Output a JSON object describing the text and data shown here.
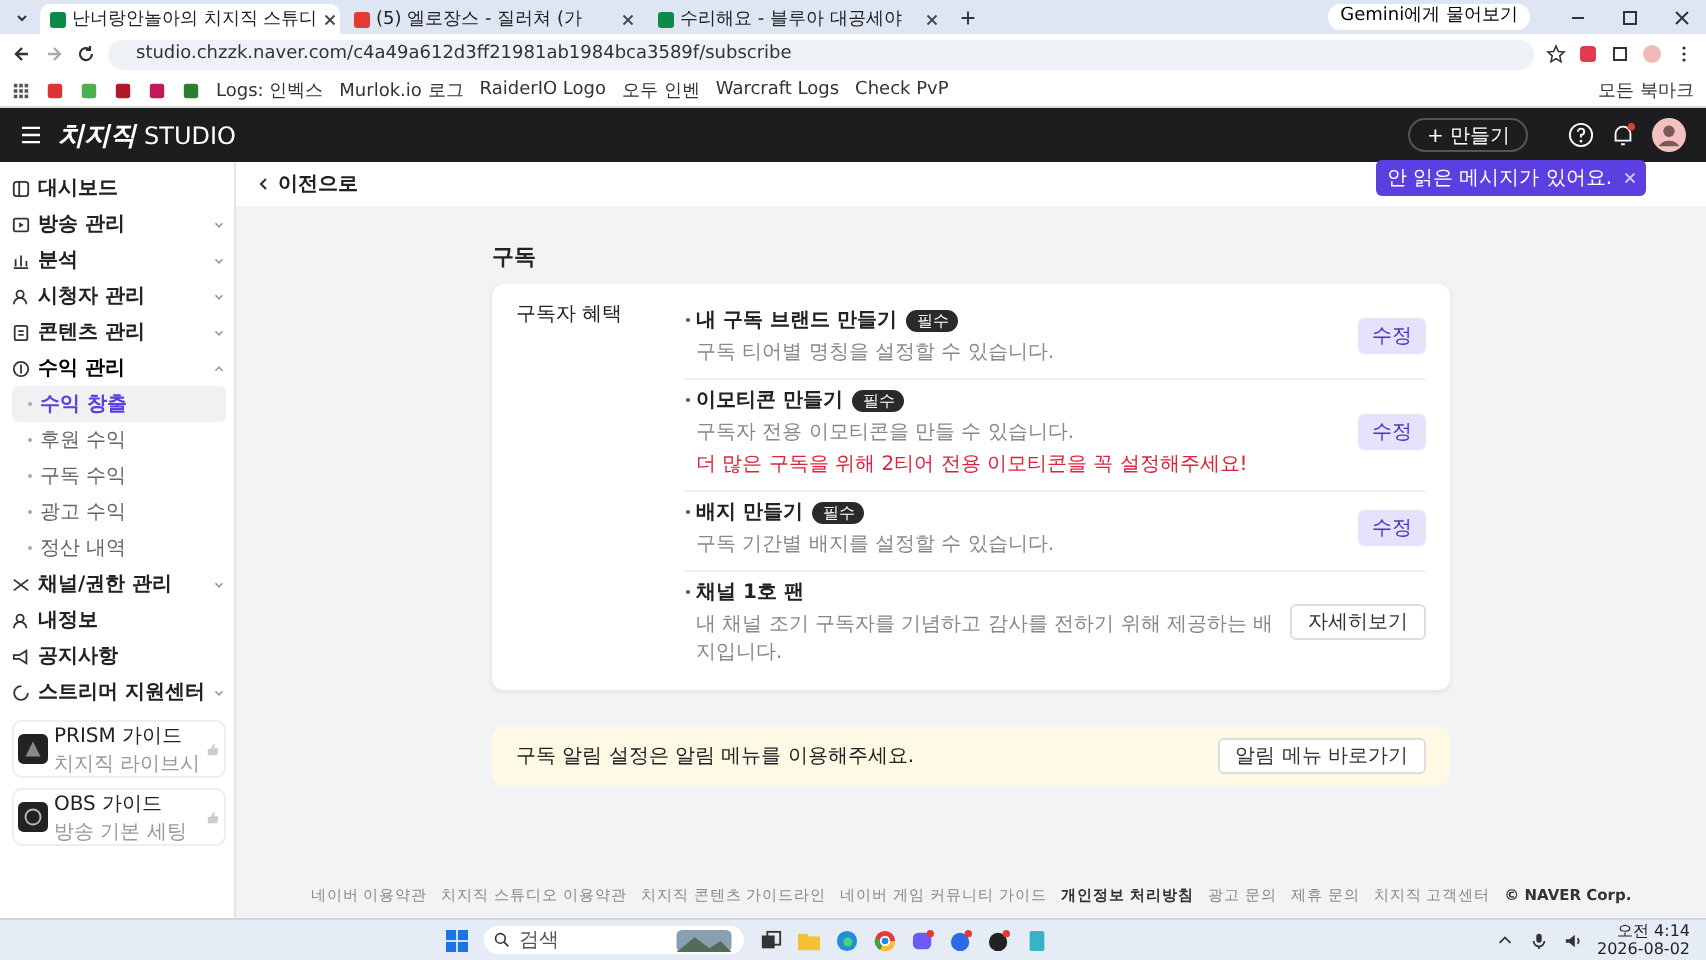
{
  "browser": {
    "tabs": [
      {
        "title": "난너랑안놀아의 치지직 스튜디",
        "selected": true
      },
      {
        "title": "(5) 엘로장스 - 질러쳐 (가",
        "selected": false
      },
      {
        "title": "수리해요 - 블루아 대공세야",
        "selected": false
      }
    ],
    "gemini_button": "Gemini에게 물어보기",
    "url": "studio.chzzk.naver.com/c4a49a612d3ff21981ab1984bca3589f/subscribe",
    "bookmarks": [
      {
        "label": "Logs: 인벡스"
      },
      {
        "label": "Murlok.io 로그"
      },
      {
        "label": "RaiderIO Logo"
      },
      {
        "label": "오두 인벤"
      },
      {
        "label": "Warcraft Logs"
      },
      {
        "label": "Check PvP"
      }
    ],
    "all_bookmarks": "모든 북마크"
  },
  "header": {
    "logo": "치지직",
    "logo_suffix": "STUDIO",
    "create_button": "+ 만들기",
    "tooltip": "안 읽은 메시지가 있어요."
  },
  "back_link": "이전으로",
  "sidebar": {
    "items": [
      {
        "label": "대시보드",
        "expandable": false,
        "expanded": false
      },
      {
        "label": "방송 관리",
        "expandable": true,
        "expanded": false
      },
      {
        "label": "분석",
        "expandable": true,
        "expanded": false
      },
      {
        "label": "시청자 관리",
        "expandable": true,
        "expanded": false
      },
      {
        "label": "콘텐츠 관리",
        "expandable": true,
        "expanded": false
      },
      {
        "label": "수익 관리",
        "expandable": true,
        "expanded": true,
        "children": [
          {
            "label": "수익 창출",
            "selected": true
          },
          {
            "label": "후원 수익",
            "selected": false
          },
          {
            "label": "구독 수익",
            "selected": false
          },
          {
            "label": "광고 수익",
            "selected": false
          },
          {
            "label": "정산 내역",
            "selected": false
          }
        ]
      },
      {
        "label": "채널/권한 관리",
        "expandable": true,
        "expanded": false
      },
      {
        "label": "내정보",
        "expandable": false,
        "expanded": false
      },
      {
        "label": "공지사항",
        "expandable": false,
        "expanded": false
      },
      {
        "label": "스트리머 지원센터",
        "expandable": true,
        "expanded": false
      }
    ],
    "guides": [
      {
        "title": "PRISM 가이드",
        "subtitle": "치지직 라이브시"
      },
      {
        "title": "OBS 가이드",
        "subtitle": "방송 기본 세팅"
      }
    ]
  },
  "page_title": "구독",
  "benefits": {
    "label": "구독자 혜택",
    "items": [
      {
        "kind": "edit",
        "title": "내 구독 브랜드 만들기",
        "badge": "필수",
        "description": "구독 티어별 명칭을 설정할 수 있습니다.",
        "button": "수정"
      },
      {
        "kind": "edit",
        "title": "이모티콘 만들기",
        "badge": "필수",
        "description": "구독자 전용 이모티콘을 만들 수 있습니다.",
        "warning": "더 많은 구독을 위해 2티어 전용 이모티콘을 꼭 설정해주세요!",
        "button": "수정"
      },
      {
        "kind": "edit",
        "title": "배지 만들기",
        "badge": "필수",
        "description": "구독 기간별 배지를 설정할 수 있습니다.",
        "button": "수정"
      },
      {
        "kind": "info",
        "title": "채널 1호 팬",
        "description": "내 채널 조기 구독자를 기념하고 감사를 전하기 위해 제공하는 배지입니다.",
        "button": "자세히보기"
      }
    ]
  },
  "notice": {
    "text": "구독 알림 설정은 알림 메뉴를 이용해주세요.",
    "button": "알림 메뉴 바로가기"
  },
  "footer": [
    {
      "label": "네이버 이용약관",
      "bold": false
    },
    {
      "label": "치지직 스튜디오 이용약관",
      "bold": false
    },
    {
      "label": "치지직 콘텐츠 가이드라인",
      "bold": false
    },
    {
      "label": "네이버 게임 커뮤니티 가이드",
      "bold": false
    },
    {
      "label": "개인정보 처리방침",
      "bold": true
    },
    {
      "label": "광고 문의",
      "bold": false
    },
    {
      "label": "제휴 문의",
      "bold": false
    },
    {
      "label": "치지직 고객센터",
      "bold": false
    },
    {
      "label": "© NAVER Corp.",
      "bold": true
    }
  ],
  "taskbar": {
    "search_placeholder": "검색",
    "time": "오전 4:14",
    "date": "2026-08-02"
  }
}
